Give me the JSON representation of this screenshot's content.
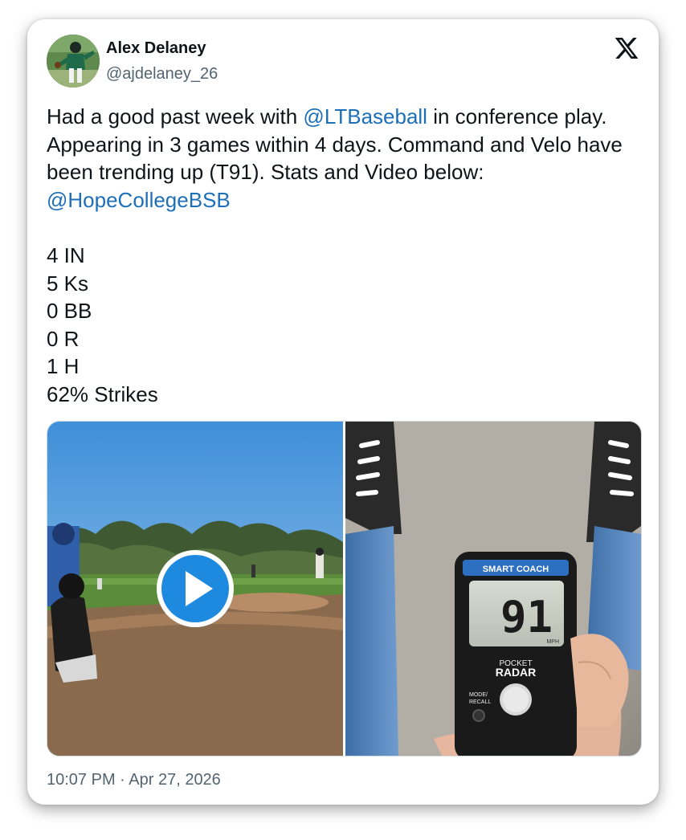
{
  "author": {
    "name": "Alex Delaney",
    "handle": "@ajdelaney_26"
  },
  "tweet": {
    "text_part1": "Had a good past week with ",
    "mention1": "@LTBaseball",
    "text_part2": " in conference play. Appearing in 3 games within 4 days. Command and Velo have been trending up (T91). Stats and Video below: ",
    "mention2": "@HopeCollegeBSB",
    "stats": [
      "4 IN",
      "5 Ks",
      "0 BB",
      "0 R",
      "1 H",
      "62% Strikes"
    ]
  },
  "media": {
    "radar": {
      "header": "SMART COACH",
      "reading": "91",
      "unit": "MPH",
      "brand_top": "POCKET",
      "brand_bottom": "RADAR",
      "button_label_top": "MODE/",
      "button_label_bottom": "RECALL"
    }
  },
  "timestamp": "10:07 PM · Apr 27, 2026",
  "colors": {
    "mention": "#1d6fb8",
    "play_button": "#1d8ae0",
    "text": "#0f1419",
    "secondary": "#536471"
  },
  "icons": [
    "x-logo-icon",
    "play-icon"
  ]
}
